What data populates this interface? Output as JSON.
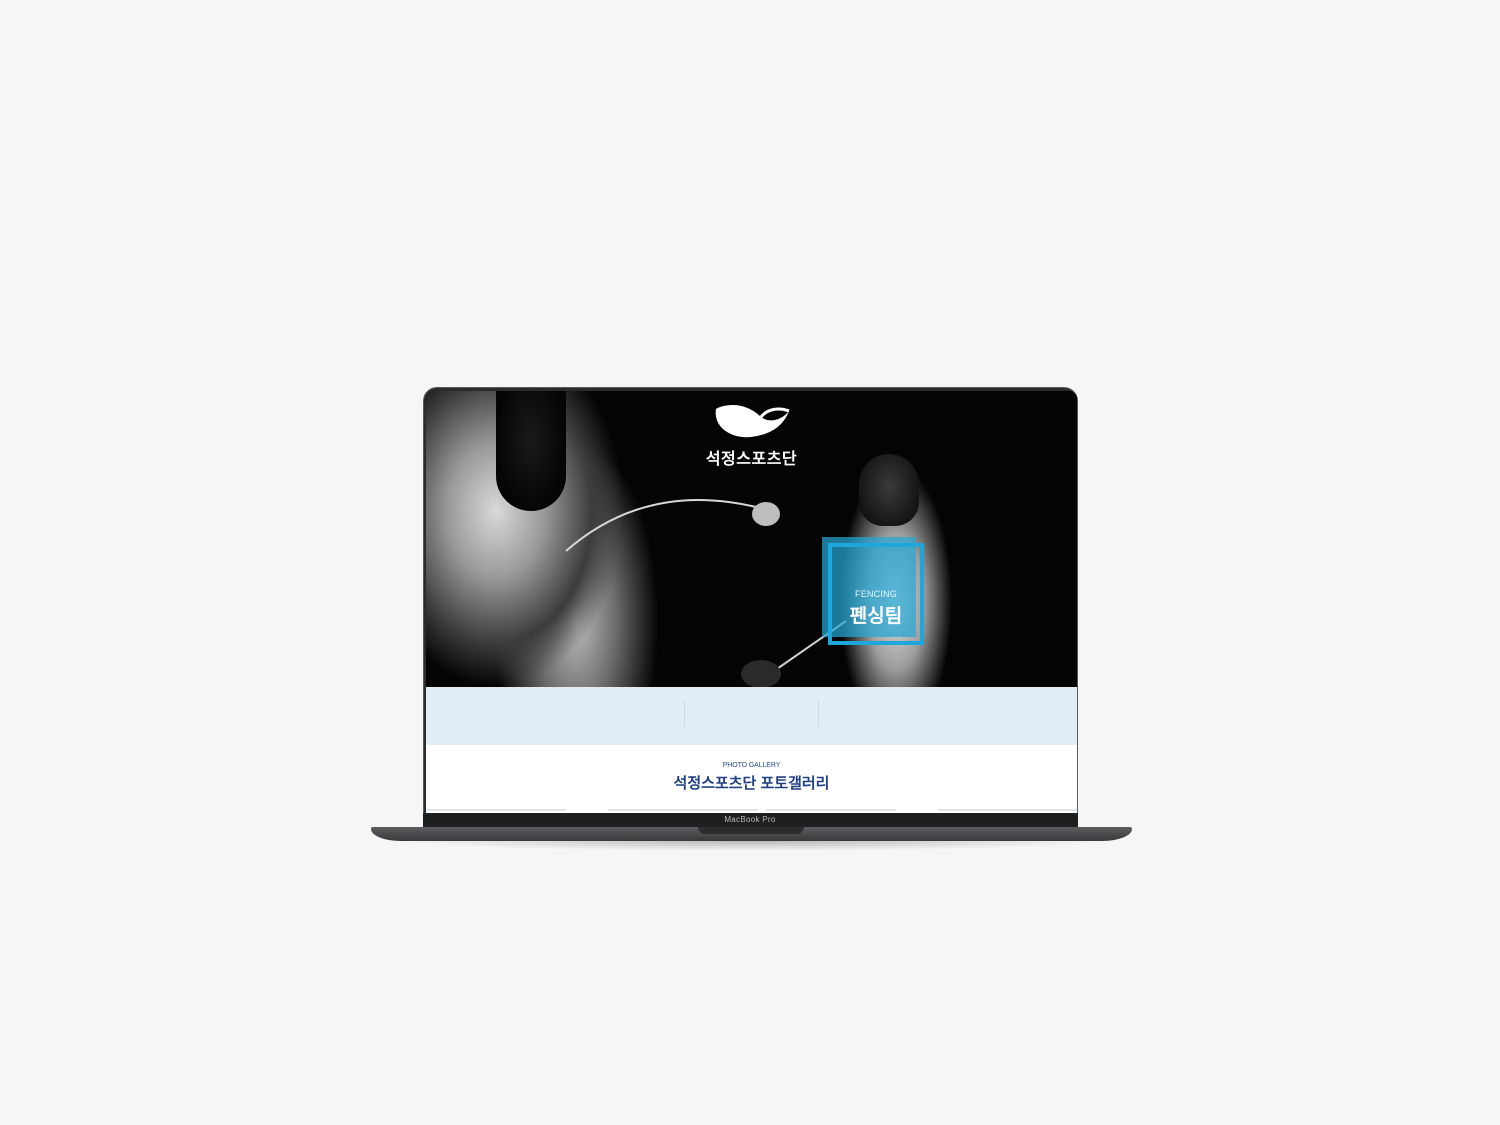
{
  "brand": {
    "name": "석정스포츠단"
  },
  "hero": {
    "team_en": "FENCING",
    "team_ko": "펜싱팀"
  },
  "gallery": {
    "subtitle": "PHOTO GALLERY",
    "title": "석정스포츠단 포토갤러리"
  },
  "device": {
    "model": "MacBook Pro"
  },
  "colors": {
    "accent": "#1fa7dc",
    "band": "#e1eef6",
    "title_blue": "#1f3f86",
    "background": "#f6f6f6"
  }
}
